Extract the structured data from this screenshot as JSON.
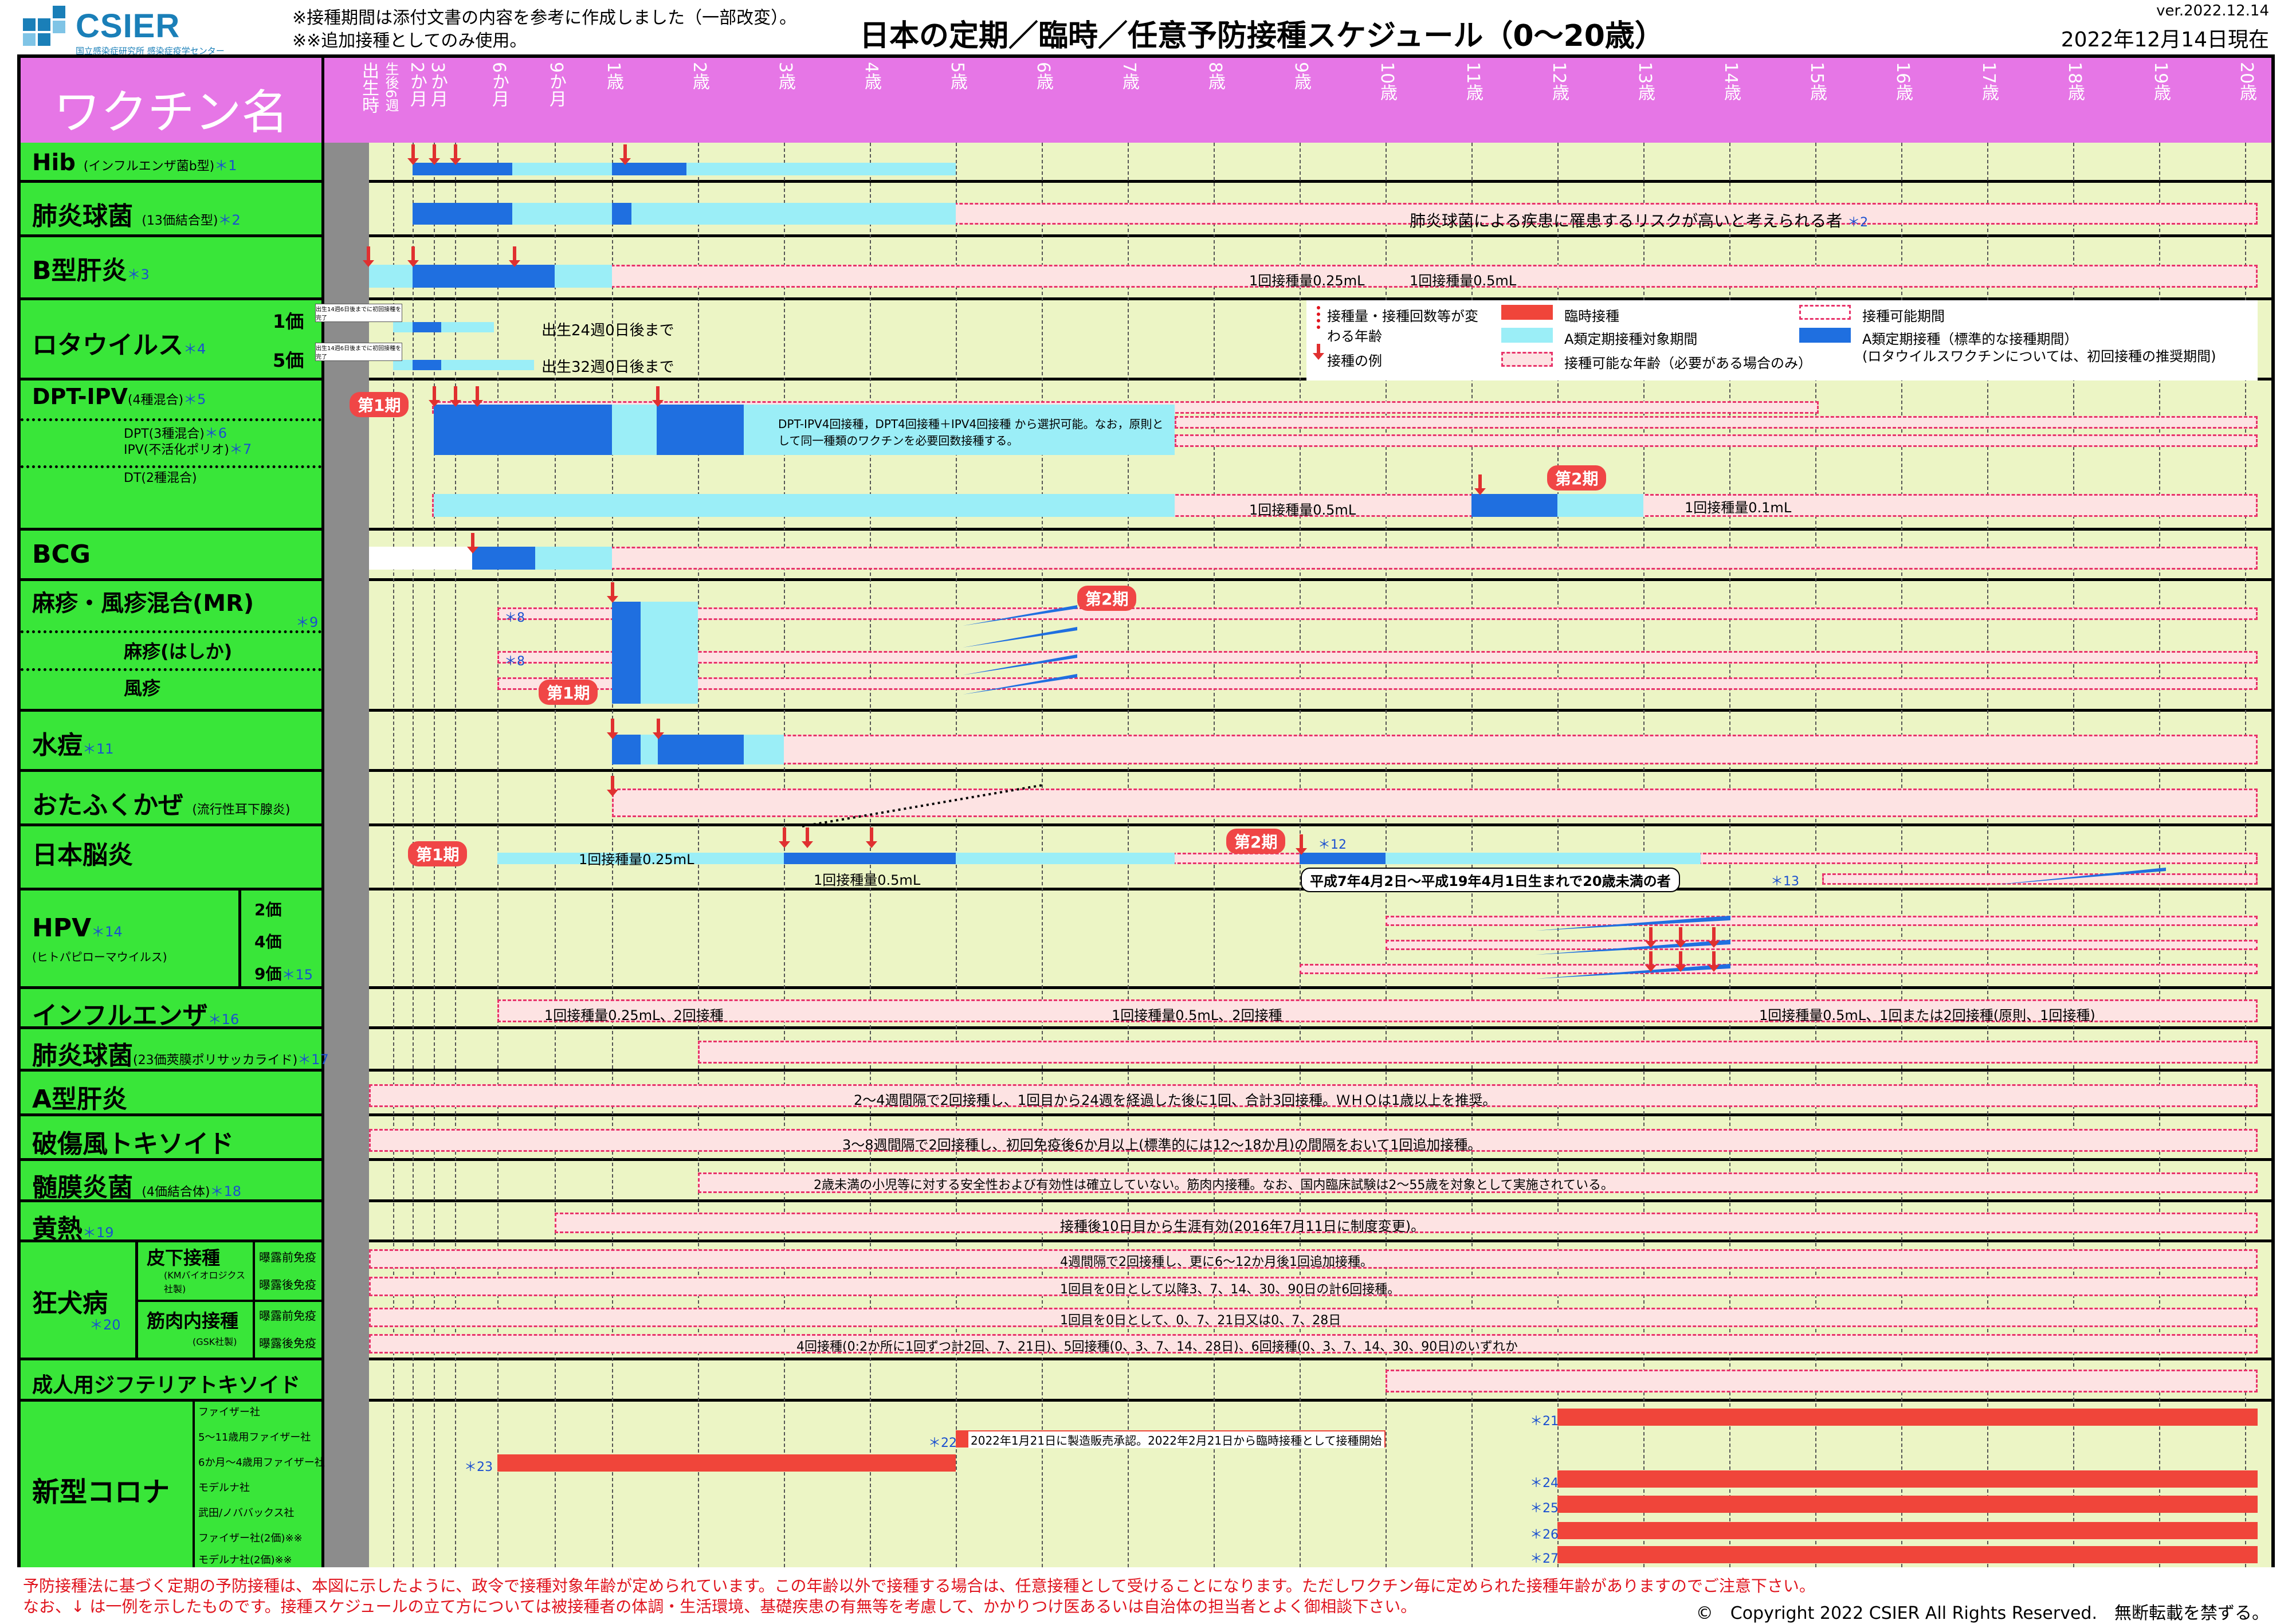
{
  "header": {
    "logo_text": "CSIER",
    "logo_sub": "国立感染症研究所 感染症疫学センター",
    "notes": [
      "※接種期間は添付文書の内容を参考に作成しました（一部改変）。",
      "※※追加接種としてのみ使用。"
    ],
    "title": "日本の定期／臨時／任意予防接種スケジュール（0〜20歳）",
    "version": "ver.2022.12.14",
    "date": "2022年12月14日現在"
  },
  "table_header": {
    "name_col": "ワクチン名",
    "ages": [
      "出生時",
      "生後6週",
      "2か月",
      "3か月",
      "6か月",
      "9か月",
      "1歳",
      "2歳",
      "3歳",
      "4歳",
      "5歳",
      "6歳",
      "7歳",
      "8歳",
      "9歳",
      "10歳",
      "11歳",
      "12歳",
      "13歳",
      "14歳",
      "15歳",
      "16歳",
      "17歳",
      "18歳",
      "19歳",
      "20歳"
    ]
  },
  "rows": {
    "hib": {
      "name": "Hib",
      "sub": "(インフルエンザ菌b型)",
      "ref": "＊1"
    },
    "pcv": {
      "name": "肺炎球菌",
      "sub": "(13価結合型)",
      "ref": "＊2",
      "note": "肺炎球菌による疾患に罹患するリスクが高いと考えられる者",
      "note_ref": "＊2"
    },
    "hepb": {
      "name": "B型肝炎",
      "ref": "＊3",
      "dose1": "1回接種量0.25mL",
      "dose2": "1回接種量0.5mL"
    },
    "rota": {
      "name": "ロタウイルス",
      "ref": "＊4",
      "v1": "1価",
      "v5": "5価",
      "small_note": "出生14週6日後までに初回接種を完了",
      "end1": "出生24週0日後まで",
      "end5": "出生32週0日後まで"
    },
    "dpt": {
      "name": "DPT-IPV",
      "sub": "(4種混合)",
      "ref": "＊5",
      "sub2": "DPT(3種混合)",
      "ref2": "＊6",
      "sub3": "IPV(不活化ポリオ)",
      "ref3": "＊7",
      "sub4": "DT(2種混合)",
      "phase1": "第1期",
      "phase2": "第2期",
      "note": "DPT-IPV4回接種，DPT4回接種＋IPV4回接種 から選択可能。なお，原則として同一種類のワクチンを必要回数接種する。",
      "dose1": "1回接種量0.5mL",
      "dose2": "1回接種量0.1mL"
    },
    "bcg": {
      "name": "BCG"
    },
    "mr": {
      "name": "麻疹・風疹混合(MR)",
      "ref": "＊9",
      "sub_measles": "麻疹(はしか)",
      "sub_rubella": "風疹",
      "phase1": "第1期",
      "phase2": "第2期",
      "ref8": "＊8"
    },
    "varicella": {
      "name": "水痘",
      "ref": "＊11"
    },
    "mumps": {
      "name": "おたふくかぜ",
      "sub": "(流行性耳下腺炎)"
    },
    "je": {
      "name": "日本脳炎",
      "phase1": "第1期",
      "phase2": "第2期",
      "dose1": "1回接種量0.25mL",
      "dose2": "1回接種量0.5mL",
      "ref12": "＊12",
      "ref13": "＊13",
      "callout": "平成7年4月2日〜平成19年4月1日生まれで20歳未満の者"
    },
    "hpv": {
      "name": "HPV",
      "ref": "＊14",
      "sub": "(ヒトパピローマウイルス)",
      "v2": "2価",
      "v4": "4価",
      "v9": "9価",
      "ref15": "＊15"
    },
    "flu": {
      "name": "インフルエンザ",
      "ref": "＊16",
      "d1": "1回接種量0.25mL、2回接種",
      "d2": "1回接種量0.5mL、2回接種",
      "d3": "1回接種量0.5mL、1回または2回接種(原則、1回接種)"
    },
    "ppsv": {
      "name": "肺炎球菌",
      "sub": "(23価莢膜ポリサッカライド)",
      "ref": "＊17"
    },
    "hepa": {
      "name": "A型肝炎",
      "note": "2〜4週間隔で2回接種し、1回目から24週を経過した後に1回、合計3回接種。ＷＨＯは1歳以上を推奨。"
    },
    "tetanus": {
      "name": "破傷風トキソイド",
      "note": "3〜8週間隔で2回接種し、初回免疫後6か月以上(標準的には12〜18か月)の間隔をおいて1回追加接種。"
    },
    "mening": {
      "name": "髄膜炎菌",
      "sub": "(4価結合体)",
      "ref": "＊18",
      "note": "2歳未満の小児等に対する安全性および有効性は確立していない。筋肉内接種。なお、国内臨床試験は2〜55歳を対象として実施されている。"
    },
    "yf": {
      "name": "黄熱",
      "ref": "＊19",
      "note": "接種後10日目から生涯有効(2016年7月11日に制度変更)。"
    },
    "rabies": {
      "name": "狂犬病",
      "ref": "＊20",
      "sc": "皮下接種",
      "sc_sub": "(KMバイオロジクス社製)",
      "im": "筋肉内接種",
      "im_sub": "(GSK社製)",
      "pre": "曝露前免疫",
      "post": "曝露後免疫",
      "n1": "4週間隔で2回接種し、更に6〜12か月後1回追加接種。",
      "n2": "1回目を0日として以降3、7、14、30、90日の計6回接種。",
      "n3": "1回目を0日として、0、7、21日又は0、7、28日",
      "n4": "4回接種(0:2か所に1回ずつ計2回、7、21日)、5回接種(0、3、7、14、28日)、6回接種(0、3、7、14、30、90日)のいずれか"
    },
    "dtadult": {
      "name": "成人用ジフテリアトキソイド"
    },
    "covid": {
      "name": "新型コロナ",
      "makers": [
        "ファイザー社",
        "5〜11歳用ファイザー社",
        "6か月〜4歳用ファイザー社",
        "モデルナ社",
        "武田/ノババックス社",
        "ファイザー社(2価)※※",
        "モデルナ社(2価)※※"
      ],
      "note": "2022年1月21日に製造販売承認。2022年2月21日から臨時接種として接種開始",
      "refs": [
        "＊21",
        "＊22",
        "＊23",
        "＊24",
        "＊25",
        "＊26",
        "＊27"
      ]
    }
  },
  "legend": {
    "l1": "接種量・接種回数等が変わる年齢",
    "l2": "接種の例",
    "l3": "臨時接種",
    "l4": "A類定期接種対象期間",
    "l5": "接種可能な年齢（必要がある場合のみ）",
    "l6": "接種可能期間",
    "l7": "A類定期接種（標準的な接種期間）",
    "l8": "(ロタウイルスワクチンについては、初回接種の推奨期間)"
  },
  "footer": {
    "line1": "予防接種法に基づく定期の予防接種は、本図に示したように、政令で接種対象年齢が定められています。この年齢以外で接種する場合は、任意接種として受けることになります。ただしワクチン毎に定められた接種年齢がありますのでご注意下さい。",
    "line2": "なお、↓ は一例を示したものです。接種スケジュールの立て方については被接種者の体調・生活環境、基礎疾患の有無等を考慮して、かかりつけ医あるいは自治体の担当者とよく御相談下さい。",
    "copyright": "©　Copyright 2022 CSIER All Rights Reserved.　無断転載を禁ずる。"
  },
  "colors": {
    "header_band": "#e676e6",
    "name_col": "#39e639",
    "grid_bg": "#ecf5c5",
    "optional": "#fde3e3",
    "optional_border": "#e8336a",
    "target_period": "#9beef7",
    "standard_period": "#1f6fe0",
    "temporary": "#f0453a"
  }
}
